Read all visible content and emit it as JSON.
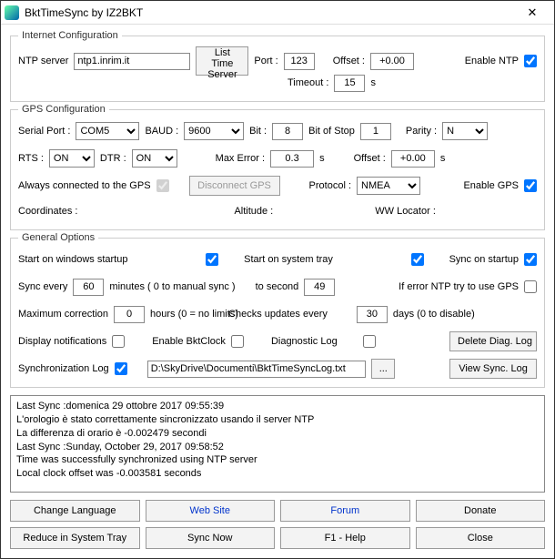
{
  "window": {
    "title": "BktTimeSync by IZ2BKT"
  },
  "internet": {
    "legend": "Internet Configuration",
    "ntp_label": "NTP server",
    "ntp_server": "ntp1.inrim.it",
    "list_time_label": "List Time Server",
    "port_label": "Port :",
    "port": "123",
    "offset_label": "Offset :",
    "offset": "+0.00",
    "timeout_label": "Timeout :",
    "timeout": "15",
    "timeout_unit": "s",
    "enable_label": "Enable NTP",
    "enabled": true
  },
  "gps": {
    "legend": "GPS Configuration",
    "serial_label": "Serial Port :",
    "serial": "COM5",
    "baud_label": "BAUD :",
    "baud": "9600",
    "bit_label": "Bit :",
    "bit": "8",
    "bitstop_label": "Bit of Stop",
    "bitstop": "1",
    "parity_label": "Parity :",
    "parity": "N",
    "rts_label": "RTS :",
    "rts": "ON",
    "dtr_label": "DTR :",
    "dtr": "ON",
    "maxerr_label": "Max Error :",
    "maxerr": "0.3",
    "maxerr_unit": "s",
    "offset_label": "Offset :",
    "offset": "+0.00",
    "offset_unit": "s",
    "always_label": "Always connected to the GPS",
    "always": true,
    "disconnect_label": "Disconnect GPS",
    "protocol_label": "Protocol :",
    "protocol": "NMEA",
    "enable_label": "Enable GPS",
    "enabled": true,
    "coord_label": "Coordinates :",
    "alt_label": "Altitude :",
    "loc_label": "WW Locator :"
  },
  "general": {
    "legend": "General Options",
    "start_win_label": "Start on windows startup",
    "start_win": true,
    "start_tray_label": "Start on system tray",
    "start_tray": true,
    "sync_start_label": "Sync on startup",
    "sync_start": true,
    "sync_every_label": "Sync every",
    "sync_every": "60",
    "sync_every_unit": "minutes ( 0 to manual sync )",
    "to_second_label": "to second",
    "to_second": "49",
    "err_gps_label": "If error NTP try to use GPS",
    "err_gps": false,
    "max_corr_label": "Maximum correction",
    "max_corr": "0",
    "max_corr_unit": "hours (0 = no limits)",
    "check_upd_label": "Checks updates every",
    "check_upd": "30",
    "check_upd_unit": "days (0 to disable)",
    "notify_label": "Display notifications",
    "notify": false,
    "bktclock_label": "Enable BktClock",
    "bktclock": false,
    "diag_label": "Diagnostic Log",
    "diag": false,
    "delete_diag_label": "Delete Diag. Log",
    "sync_log_label": "Synchronization Log",
    "sync_log": true,
    "log_path": "D:\\SkyDrive\\Documenti\\BktTimeSyncLog.txt",
    "view_log_label": "View Sync. Log"
  },
  "log_text": "Last Sync :domenica 29 ottobre 2017 09:55:39\nL'orologio è stato correttamente sincronizzato usando il server NTP\nLa differenza di orario è -0.002479 secondi\nLast Sync :Sunday, October 29, 2017 09:58:52\nTime was successfully synchronized using NTP server\nLocal clock offset was -0.003581 seconds",
  "buttons": {
    "lang": "Change Language",
    "web": "Web Site",
    "forum": "Forum",
    "donate": "Donate",
    "reduce": "Reduce in System Tray",
    "syncnow": "Sync Now",
    "help": "F1 - Help",
    "close": "Close"
  }
}
